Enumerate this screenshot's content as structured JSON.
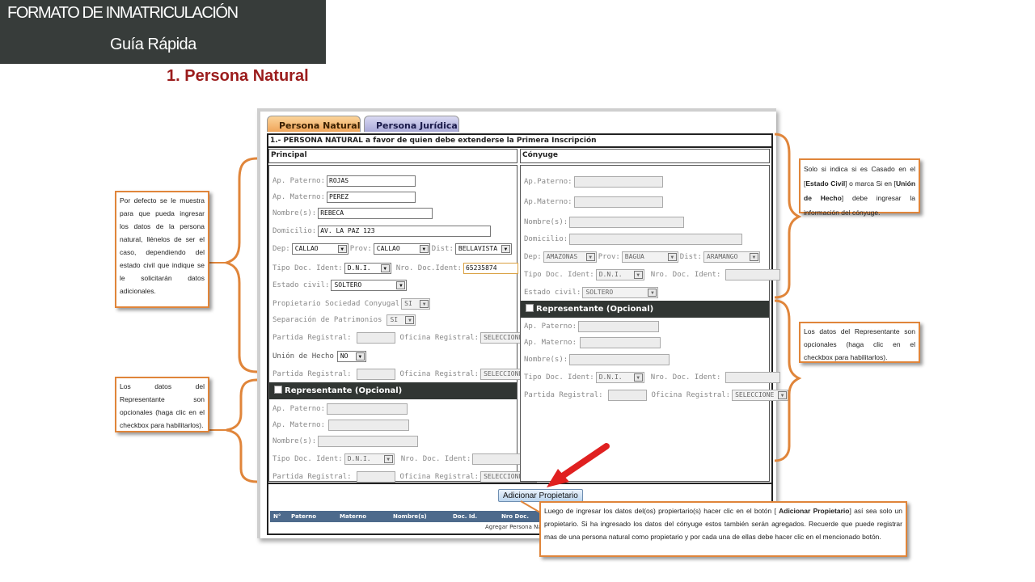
{
  "header": {
    "title": "FORMATO DE INMATRICULACIÓN",
    "subtitle": "Guía Rápida"
  },
  "section_title": "1. Persona Natural",
  "tabs": [
    {
      "label": "Persona Natural"
    },
    {
      "label": "Persona Jurídica"
    }
  ],
  "form": {
    "bar_title": "1.- PERSONA NATURAL a favor de quien debe extenderse la Primera Inscripción",
    "principal": {
      "heading": "Principal",
      "ap_paterno": {
        "label": "Ap. Paterno:",
        "value": "ROJAS"
      },
      "ap_materno": {
        "label": "Ap. Materno:",
        "value": "PEREZ"
      },
      "nombres": {
        "label": "Nombre(s):",
        "value": "REBECA"
      },
      "domicilio": {
        "label": "Domicilio:",
        "value": "AV. LA PAZ 123"
      },
      "dep": {
        "label": "Dep:",
        "value": "CALLAO"
      },
      "prov": {
        "label": "Prov:",
        "value": "CALLAO"
      },
      "dist": {
        "label": "Dist:",
        "value": "BELLAVISTA"
      },
      "tipo_doc": {
        "label": "Tipo Doc. Ident:",
        "value": "D.N.I."
      },
      "nro_doc": {
        "label": "Nro. Doc.Ident:",
        "value": "65235874"
      },
      "estado_civil": {
        "label": "Estado civil:",
        "value": "SOLTERO"
      },
      "propietario_soc": {
        "label": "Propietario Sociedad Conyugal",
        "value": "SI"
      },
      "separacion": {
        "label": "Separación de Patrimonios",
        "value": "SI"
      },
      "partida1": {
        "label": "Partida Registral:",
        "value": ""
      },
      "oficina1": {
        "label": "Oficina Registral:",
        "value": "SELECCIONE"
      },
      "union_hecho": {
        "label": "Unión de Hecho",
        "value": "NO"
      },
      "partida2": {
        "label": "Partida Registral:",
        "value": ""
      },
      "oficina2": {
        "label": "Oficina Registral:",
        "value": "SELECCIONE"
      },
      "rep": {
        "title": "Representante (Opcional)",
        "ap_paterno": "Ap. Paterno:",
        "ap_materno": "Ap. Materno:",
        "nombres": "Nombre(s):",
        "tipo_doc": {
          "label": "Tipo Doc. Ident:",
          "value": "D.N.I."
        },
        "nro_doc": "Nro. Doc. Ident:",
        "partida": "Partida Registral:",
        "oficina": {
          "label": "Oficina Registral:",
          "value": "SELECCIONE"
        }
      }
    },
    "conyuge": {
      "heading": "Cónyuge",
      "ap_paterno": "Ap.Paterno:",
      "ap_materno": "Ap.Materno:",
      "nombres": "Nombre(s):",
      "domicilio": "Domicilio:",
      "dep": {
        "label": "Dep:",
        "value": "AMAZONAS"
      },
      "prov": {
        "label": "Prov:",
        "value": "BAGUA"
      },
      "dist": {
        "label": "Dist:",
        "value": "ARAMANGO"
      },
      "tipo_doc": {
        "label": "Tipo Doc. Ident:",
        "value": "D.N.I."
      },
      "nro_doc": "Nro. Doc. Ident:",
      "estado_civil": {
        "label": "Estado civil:",
        "value": "SOLTERO"
      },
      "rep": {
        "title": "Representante (Opcional)",
        "ap_paterno": "Ap. Paterno:",
        "ap_materno": "Ap. Materno:",
        "nombres": "Nombre(s):",
        "tipo_doc": {
          "label": "Tipo Doc. Ident:",
          "value": "D.N.I."
        },
        "nro_doc": "Nro. Doc. Ident:",
        "partida": "Partida Registral:",
        "oficina": {
          "label": "Oficina Registral:",
          "value": "SELECCIONE"
        }
      }
    },
    "add_button": "Adicionar Propietario",
    "table_headers": [
      "N°",
      "Paterno",
      "Materno",
      "Nombre(s)",
      "Doc. Id.",
      "Nro Doc."
    ],
    "agregar_text": "Agregar Persona Na"
  },
  "callouts": {
    "left_top": "Por defecto se le muestra para que pueda ingresar los datos de la persona natural, llénelos de ser el caso, dependiendo del estado civil que indique se le solicitarán datos adicionales.",
    "left_bottom": "Los datos del Representante son opcionales (haga clic en el checkbox para habilitarlos).",
    "right_top": {
      "p1": "Solo si indica si es Casado en el [",
      "b1": "Estado Civil",
      "p2": "] o marca Si en [",
      "b2": "Unión de Hecho",
      "p3": "] debe ingresar la información del cónyuge."
    },
    "right_mid": "Los datos del Representante son opcionales (haga clic en el checkbox para habilitarlos).",
    "bottom": {
      "p1": "Luego de ingresar los datos del(os) propiertario(s) hacer clic en el botón [ ",
      "b1": "Adicionar Propietario",
      "p2": "] así sea solo un propietario. Si ha ingresado los datos del cónyuge estos también serán agregados. Recuerde que puede registrar mas de una persona natural como propietario y por cada una de ellas debe hacer clic en el mencionado botón."
    }
  },
  "colors": {
    "header_bg": "#373c3a",
    "section_title": "#9b1c1c",
    "callout_border": "#e0853a",
    "brace": "#e0853a",
    "arrow": "#e02020",
    "rep_bar": "#313633",
    "table_head": "#4d6a8c"
  }
}
